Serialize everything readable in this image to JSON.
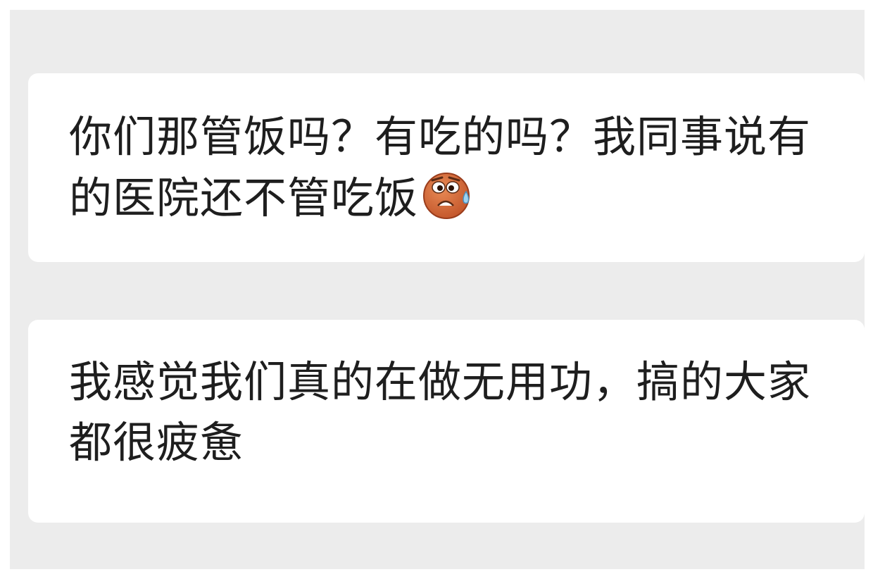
{
  "messages": [
    {
      "text": "你们那管饭吗？有吃的吗？我同事说有的医院还不管吃饭",
      "emoji": "sweating-frown-emoji-icon"
    },
    {
      "text": "我感觉我们真的在做无用功，搞的大家都很疲惫"
    }
  ],
  "colors": {
    "chat_background": "#ececec",
    "bubble_background": "#ffffff",
    "text": "#1e1e1e",
    "emoji_face": "#d2683a"
  }
}
